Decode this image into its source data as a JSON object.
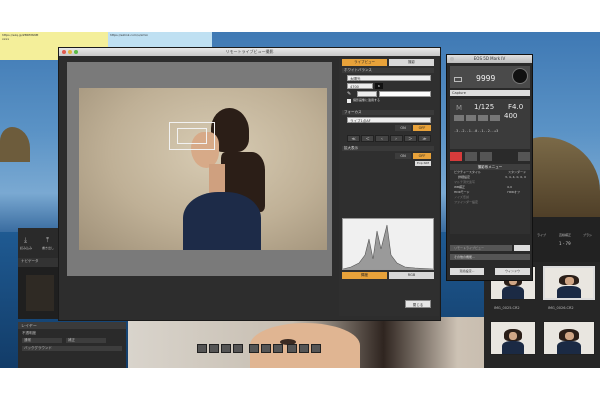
{
  "desktop": {
    "sticky_note_1_line1": "https://ezq.jp/ZBRMSNM",
    "sticky_note_1_line2": "xxxx",
    "sticky_note_2": "https://ezlink.com/u/xmin"
  },
  "lightroom_left": {
    "import_label": "読み込み",
    "export_label": "書き出し",
    "navigator_label": "ナビゲータ",
    "layer_label": "レイヤー",
    "opacity_label": "不透明度",
    "layer_blend_1": "通常",
    "layer_blend_2": "補正",
    "layer_background": "バックグラウンド"
  },
  "live_view": {
    "window_title": "リモートライブビュー撮影",
    "tab_live": "ライブビュー",
    "tab_setting": "撮影",
    "white_balance_label": "ホワイトバランス",
    "wb_value": "太陽光",
    "kelvin_value": "4700",
    "wb_checkbox_label": "撮影画像に適用する",
    "focus_label": "フォーカス",
    "focus_mode": "ライブ1点AF",
    "af_on": "ON",
    "af_off": "OFF",
    "zoom_label": "拡大表示",
    "zoom_on": "ON",
    "zoom_off": "OFF",
    "exp_sim": "Exp.SIM",
    "brightness_btn": "輝度",
    "rgb_btn": "RGB",
    "close_btn": "閉じる"
  },
  "eos": {
    "window_title": "EOS 5D Mark IV",
    "shots_remaining": "9999",
    "capture_label": "Capture",
    "mode": "M",
    "shutter": "1/125",
    "aperture": "F4.0",
    "iso": "400",
    "exposure_scale": "-3..2..1..0..1..2..+3",
    "menu_title": "撮影系メニュー",
    "menu_picture_style": "ピクチャースタイル",
    "menu_picture_style_value": "スタンダード",
    "menu_detail_label": "詳細設定",
    "menu_detail_value": "3, 4, 4, 0, 0, 0",
    "menu_wb_shift": "WB補正",
    "menu_wb_shift_value": "0,0",
    "menu_hdr": "HDRモード",
    "menu_hdr_value": "HDRオフ",
    "menu_grayed_1": "マルチ測光連写",
    "menu_grayed_2": "ノイズ低減",
    "menu_fine": "ファインダー設定",
    "btn_live_view": "リモートライブビュー",
    "btn_other": "その他の機能...",
    "btn_preferences": "環境設定...",
    "btn_window": "ウィンドウ"
  },
  "lightroom_right": {
    "count_label": "1 - 79",
    "thumb1_name": "IMG_0025.CR2",
    "thumb2_name": "IMG_0026.CR2",
    "right_label_1": "ライブ",
    "right_label_2": "直線補正",
    "right_label_3": "ブラシ"
  }
}
